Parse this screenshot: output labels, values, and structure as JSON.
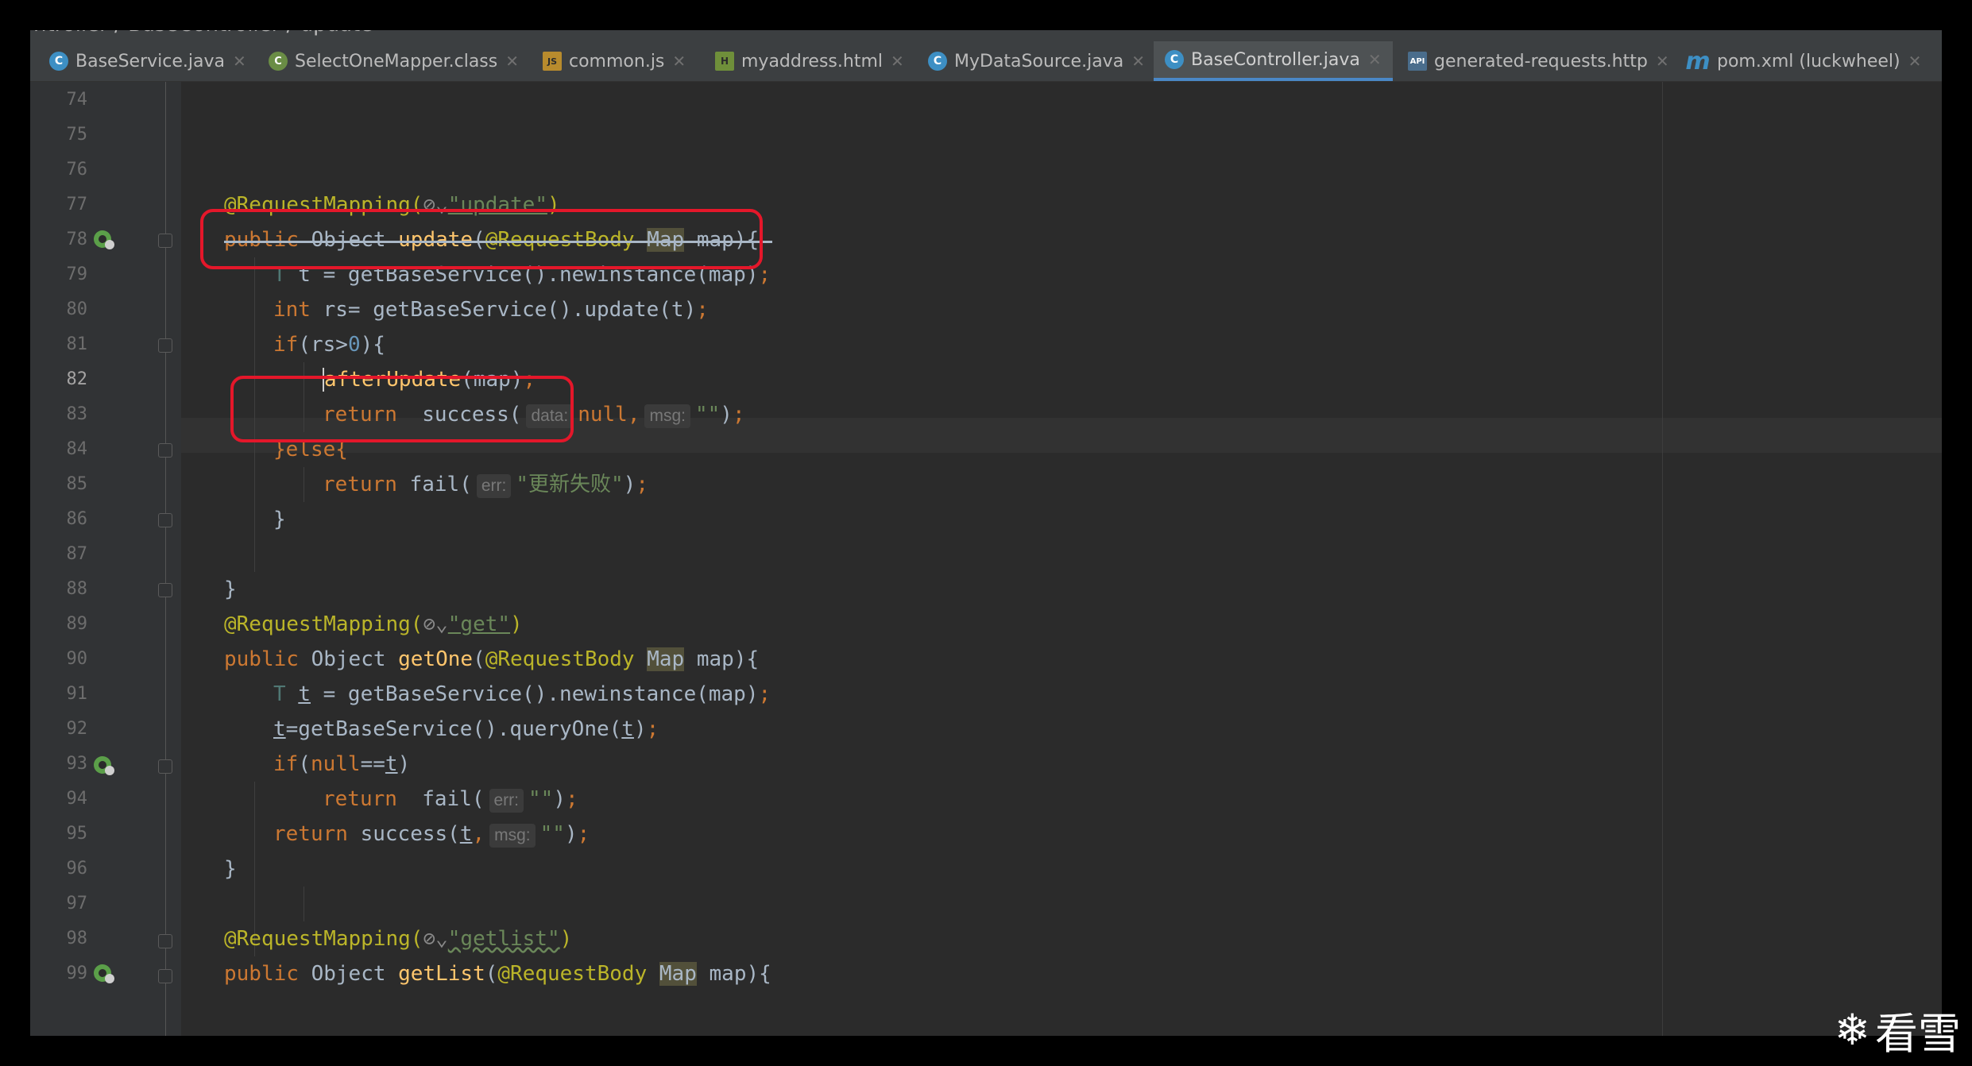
{
  "breadcrumb": "ntroller / BaseController / update",
  "tabs": [
    {
      "label": "BaseService.java",
      "icon": "java-class-icon",
      "active": false
    },
    {
      "label": "SelectOneMapper.class",
      "icon": "compiled-class-icon",
      "active": false
    },
    {
      "label": "common.js",
      "icon": "javascript-file-icon",
      "active": false
    },
    {
      "label": "myaddress.html",
      "icon": "html-file-icon",
      "active": false
    },
    {
      "label": "MyDataSource.java",
      "icon": "java-class-icon",
      "active": false
    },
    {
      "label": "BaseController.java",
      "icon": "java-class-icon",
      "active": true
    },
    {
      "label": "generated-requests.http",
      "icon": "http-api-icon",
      "active": false
    },
    {
      "label": "pom.xml (luckwheel)",
      "icon": "maven-icon",
      "active": false
    }
  ],
  "line_numbers": [
    "74",
    "75",
    "76",
    "77",
    "78",
    "79",
    "80",
    "81",
    "82",
    "83",
    "84",
    "85",
    "86",
    "87",
    "88",
    "89",
    "90",
    "91",
    "92",
    "93",
    "94",
    "95",
    "96",
    "97",
    "98",
    "99"
  ],
  "current_line": "82",
  "code": {
    "l77_ann": "@RequestMapping(",
    "l77_str": "\"update\"",
    "l77_end": ")",
    "l78_public": "public",
    "l78_obj": " Object ",
    "l78_fn": "update",
    "l78_open": "(",
    "l78_ann": "@RequestBody",
    "l78_map": "Map",
    "l78_end": " map){",
    "l79_t": "T",
    "l79_rest": " t = getBaseService().newinstance(map)",
    "l80_int": "int",
    "l80_rest": " rs= getBaseService().update(t)",
    "l81_if": "if",
    "l81_rest": "(rs>",
    "l81_num": "0",
    "l81_end": "){",
    "l82_fn": "afterUpdate",
    "l82_rest": "(map)",
    "l83_return": "return",
    "l83_fn": "  success(",
    "l83_hint_data": "data:",
    "l83_null": "null",
    "l83_hint_msg": "msg:",
    "l83_str": "\"\"",
    "l83_end": ")",
    "l84_else": "}else{",
    "l85_return": "return",
    "l85_fn": " fail(",
    "l85_hint_err": "err:",
    "l85_str": "\"更新失败\"",
    "l85_end": ")",
    "l86": "}",
    "l88": "}",
    "l89_ann": "@RequestMapping(",
    "l89_str": "\"get\"",
    "l89_end": ")",
    "l90_public": "public",
    "l90_obj": " Object ",
    "l90_fn": "getOne",
    "l90_open": "(",
    "l90_ann": "@RequestBody",
    "l90_map": "Map",
    "l90_end": " map){",
    "l91_t": "T",
    "l91_var": "t",
    "l91_rest": " = getBaseService().newinstance(map)",
    "l92_var": "t",
    "l92_rest": "=getBaseService().queryOne(",
    "l92_var2": "t",
    "l92_end": ")",
    "l93_if": "if",
    "l93_open": "(",
    "l93_null": "null",
    "l93_eq": "==",
    "l93_var": "t",
    "l93_end": ")",
    "l94_return": "return",
    "l94_fn": "  fail(",
    "l94_hint_err": "err:",
    "l94_str": "\"\"",
    "l94_end": ")",
    "l95_return": "return",
    "l95_fn": " success(",
    "l95_var": "t",
    "l95_hint_msg": "msg:",
    "l95_str": "\"\"",
    "l95_end": ")",
    "l96": "}",
    "l98_ann": "@RequestMapping(",
    "l98_str": "\"getlist\"",
    "l98_end": ")",
    "l99_public": "public",
    "l99_obj": " Object ",
    "l99_fn": "getList",
    "l99_open": "(",
    "l99_ann": "@RequestBody",
    "l99_map": "Map",
    "l99_end": " map){",
    "semi": ";",
    "comma": ","
  },
  "watermark": "看雪",
  "colors": {
    "highlight_box": "#e4172a",
    "active_tab_underline": "#4a88c7"
  }
}
